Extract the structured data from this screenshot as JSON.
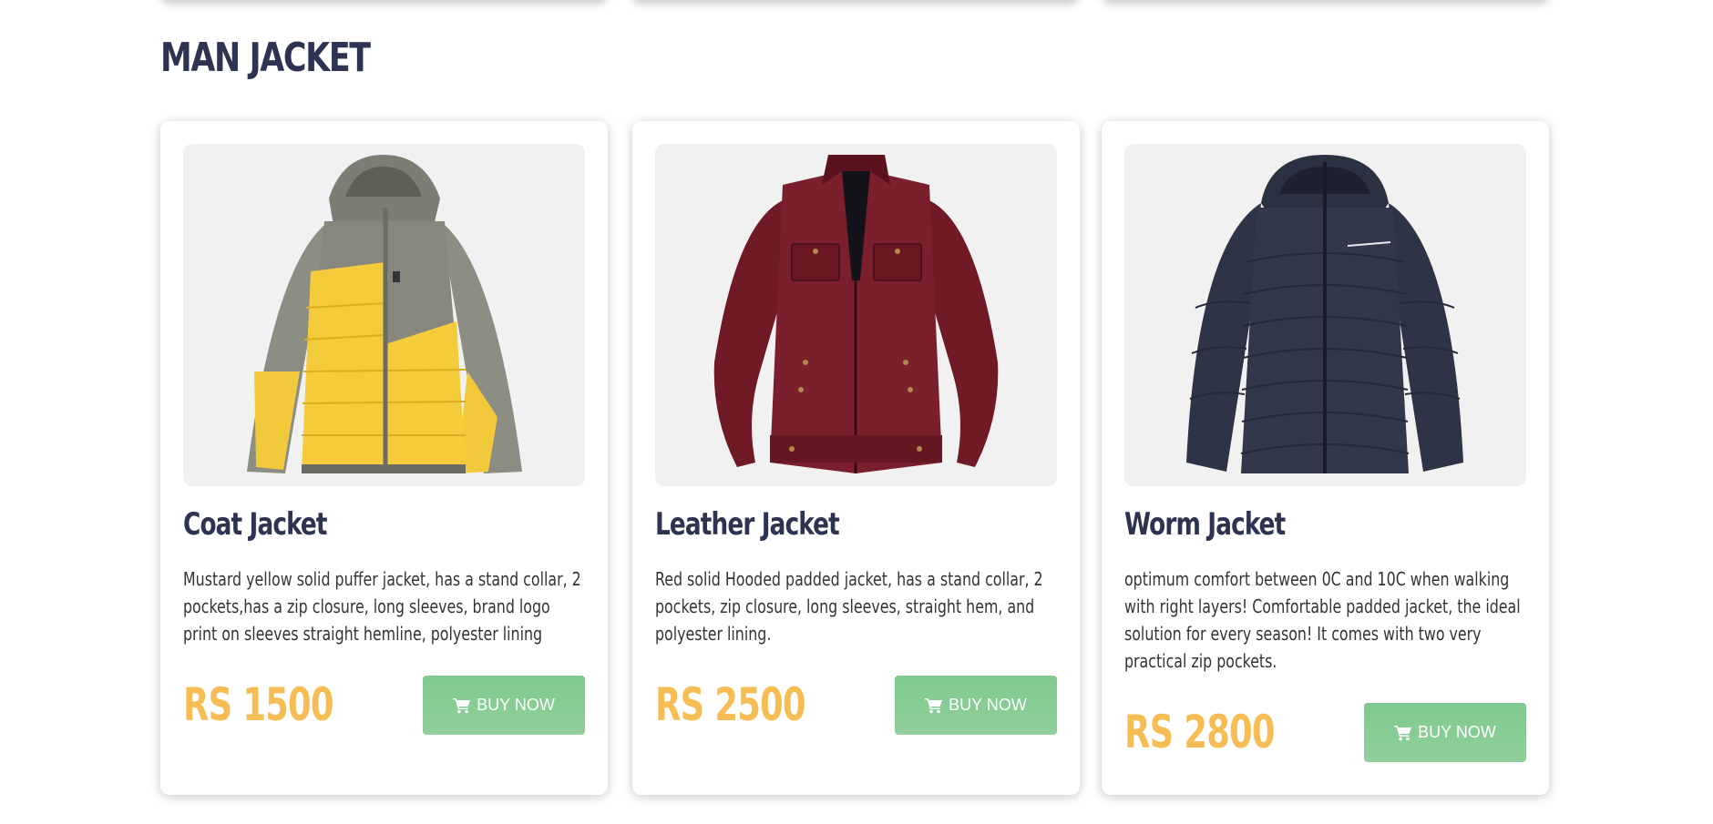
{
  "section": {
    "title": "MAN JACKET"
  },
  "products": [
    {
      "name": "Coat Jacket",
      "description": "Mustard yellow solid puffer jacket, has a stand collar, 2 pockets,has a zip closure, long sleeves, brand logo print on sleeves straight hemline, polyester lining",
      "price": "RS 1500",
      "button_label": "BUY NOW",
      "image_icon": "yellow-puffer-jacket"
    },
    {
      "name": "Leather Jacket",
      "description": "Red solid Hooded padded jacket, has a stand collar, 2 pockets, zip closure, long sleeves, straight hem, and polyester lining.",
      "price": "RS 2500",
      "button_label": "BUY NOW",
      "image_icon": "maroon-leather-jacket"
    },
    {
      "name": "Worm Jacket",
      "description": "optimum comfort between 0C and 10C when walking with right layers! Comfortable padded jacket, the ideal solution for every season! It comes with two very practical zip pockets.",
      "price": "RS 2800",
      "button_label": "BUY NOW",
      "image_icon": "navy-puffer-jacket"
    }
  ],
  "colors": {
    "heading": "#2d3351",
    "price": "#f6bd55",
    "button": "#7fc98d",
    "image_bg": "#f1f1f1"
  }
}
